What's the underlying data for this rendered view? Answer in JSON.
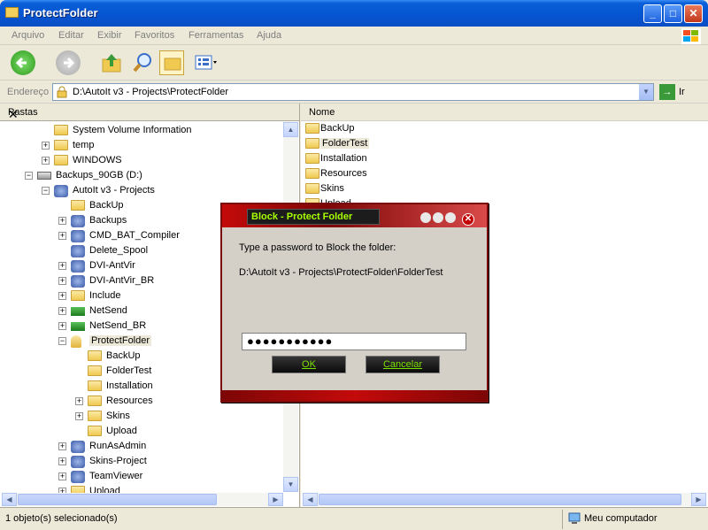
{
  "window": {
    "title": "ProtectFolder",
    "minimize": "_",
    "maximize": "□",
    "close": "✕"
  },
  "menu": [
    "Arquivo",
    "Editar",
    "Exibir",
    "Favoritos",
    "Ferramentas",
    "Ajuda"
  ],
  "address": {
    "label": "Endereço",
    "value": "D:\\AutoIt v3 - Projects\\ProtectFolder",
    "go": "Ir"
  },
  "tree": {
    "header": "Pastas",
    "close": "✕",
    "items": [
      {
        "label": "System Volume Information",
        "pm": ""
      },
      {
        "label": "temp",
        "pm": "+"
      },
      {
        "label": "WINDOWS",
        "pm": "+"
      },
      {
        "label": "Backups_90GB (D:)",
        "pm": "−"
      },
      {
        "label": "AutoIt v3 - Projects",
        "pm": "−"
      },
      {
        "label": "BackUp",
        "pm": ""
      },
      {
        "label": "Backups",
        "pm": "+"
      },
      {
        "label": "CMD_BAT_Compiler",
        "pm": "+"
      },
      {
        "label": "Delete_Spool",
        "pm": ""
      },
      {
        "label": "DVI-AntVir",
        "pm": "+"
      },
      {
        "label": "DVI-AntVir_BR",
        "pm": "+"
      },
      {
        "label": "Include",
        "pm": "+"
      },
      {
        "label": "NetSend",
        "pm": "+"
      },
      {
        "label": "NetSend_BR",
        "pm": "+"
      },
      {
        "label": "ProtectFolder",
        "pm": "−"
      },
      {
        "label": "BackUp",
        "pm": ""
      },
      {
        "label": "FolderTest",
        "pm": ""
      },
      {
        "label": "Installation",
        "pm": ""
      },
      {
        "label": "Resources",
        "pm": "+"
      },
      {
        "label": "Skins",
        "pm": "+"
      },
      {
        "label": "Upload",
        "pm": ""
      },
      {
        "label": "RunAsAdmin",
        "pm": "+"
      },
      {
        "label": "Skins-Project",
        "pm": "+"
      },
      {
        "label": "TeamViewer",
        "pm": "+"
      },
      {
        "label": "Upload",
        "pm": "+"
      }
    ]
  },
  "files": {
    "header": "Nome",
    "items": [
      "BackUp",
      "FolderTest",
      "Installation",
      "Resources",
      "Skins",
      "Upload"
    ]
  },
  "status": {
    "left": "1 objeto(s) selecionado(s)",
    "right": "Meu computador"
  },
  "dialog": {
    "title": "Block - Protect Folder",
    "close": "✕",
    "prompt": "Type a password to Block the folder:",
    "path": "D:\\AutoIt v3 - Projects\\ProtectFolder\\FolderTest",
    "password_value": "●●●●●●●●●●●",
    "ok": "OK",
    "cancel": "Cancelar"
  },
  "colors": {
    "titlebar": "#0654d0",
    "dialog_accent": "#c40a0a",
    "dialog_text": "#7ce000"
  }
}
